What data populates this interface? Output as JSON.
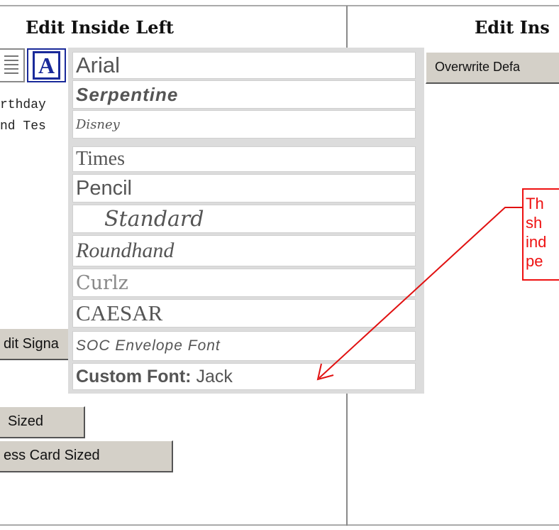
{
  "left_panel": {
    "title": "Edit Inside Left",
    "text_lines": [
      "rthday",
      "nd Tes"
    ],
    "edit_signature_label": "dit Signa",
    "sized_label": "Sized",
    "business_card_label": "ess Card Sized"
  },
  "right_panel": {
    "title": "Edit Ins",
    "overwrite_label": "Overwrite Defa"
  },
  "toolbar": {
    "font_button_glyph": "A"
  },
  "font_menu": {
    "items": [
      "Arial",
      "Serpentine",
      "Disney",
      "Times",
      "Pencil",
      "Standard",
      "Roundhand",
      "Curlz",
      "CAESAR",
      "SOC Envelope Font"
    ],
    "custom_label": "Custom Font:",
    "custom_value": "Jack"
  },
  "annotation": {
    "lines": [
      "Th",
      "sh",
      "ind",
      "pe"
    ],
    "color": "#e11111"
  }
}
